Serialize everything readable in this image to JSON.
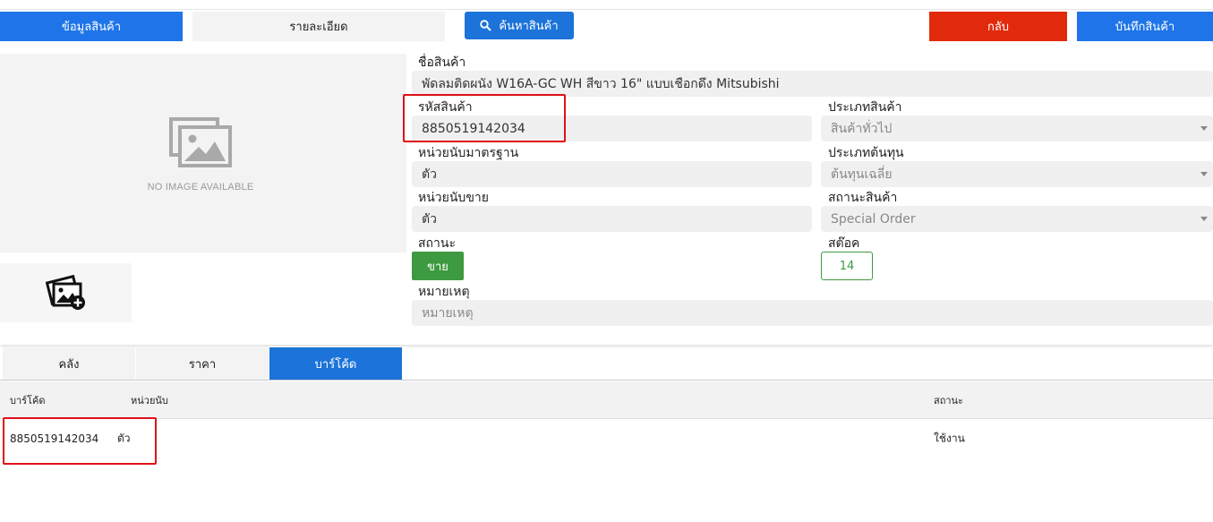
{
  "toolbar": {
    "info_label": "ข้อมูลสินค้า",
    "detail_label": "รายละเอียด",
    "search_label": "ค้นหาสินค้า",
    "back_label": "กลับ",
    "save_label": "บันทึกสินค้า"
  },
  "image": {
    "no_image_text": "NO IMAGE AVAILABLE"
  },
  "form": {
    "name_label": "ชื่อสินค้า",
    "name_value": "พัดลมติดผนัง W16A-GC WH สีขาว 16\" แบบเชือกดึง Mitsubishi",
    "code_label": "รหัสสินค้า",
    "code_value": "8850519142034",
    "type_label": "ประเภทสินค้า",
    "type_value": "สินค้าทั่วไป",
    "std_unit_label": "หน่วยนับมาตรฐาน",
    "std_unit_value": "ตัว",
    "cost_type_label": "ประเภทต้นทุน",
    "cost_type_value": "ต้นทุนเฉลี่ย",
    "sale_unit_label": "หน่วยนับขาย",
    "sale_unit_value": "ตัว",
    "product_status_label": "สถานะสินค้า",
    "product_status_value": "Special Order",
    "status_label": "สถานะ",
    "status_value": "ขาย",
    "stock_label": "สต๊อค",
    "stock_value": "14",
    "note_label": "หมายเหตุ",
    "note_placeholder": "หมายเหตุ"
  },
  "tabs": {
    "warehouse": "คลัง",
    "price": "ราคา",
    "barcode": "บาร์โค้ด"
  },
  "table": {
    "headers": {
      "barcode": "บาร์โค้ด",
      "unit": "หน่วยนับ",
      "status": "สถานะ"
    },
    "rows": [
      {
        "barcode": "8850519142034",
        "unit": "ตัว",
        "status": "ใช้งาน"
      }
    ]
  },
  "colors": {
    "primary": "#1e74e8",
    "danger": "#e12a0b",
    "success": "#3e9a40",
    "highlight": "#e0101a"
  }
}
